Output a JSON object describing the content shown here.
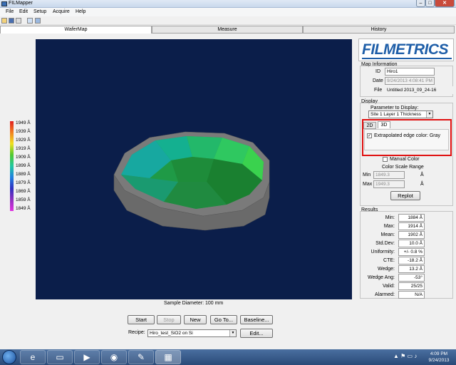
{
  "window": {
    "title": "FILMapper"
  },
  "menu": [
    "File",
    "Edit",
    "Setup",
    "Acquire",
    "Help"
  ],
  "tabs": {
    "wafermap": "WaferMap",
    "measure": "Measure",
    "history": "History"
  },
  "legend": [
    "1949 Å",
    "1939 Å",
    "1929 Å",
    "1919 Å",
    "1909 Å",
    "1899 Å",
    "1889 Å",
    "1879 Å",
    "1869 Å",
    "1859 Å",
    "1849 Å"
  ],
  "sample_diameter": "Sample Diameter: 100 mm",
  "buttons": {
    "start": "Start",
    "stop": "Stop",
    "new": "New",
    "goto": "Go To...",
    "baseline": "Baseline...",
    "edit": "Edit...",
    "replot": "Replot"
  },
  "recipe": {
    "label": "Recipe:",
    "value": "Hiro_test_SiO2 on Si"
  },
  "logo": "FILMETRICS",
  "map_info": {
    "title": "Map Information",
    "id_label": "ID",
    "id_value": "Hiro1",
    "date_label": "Date",
    "date_value": "9/24/2013 4:08:41 PM",
    "file_label": "File",
    "file_value": "Untitled 2013_09_24-16"
  },
  "display": {
    "title": "Display",
    "param_label": "Parameter to Display:",
    "param_value": "Site 1 Layer 1 Thickness",
    "tab_2d": "2D",
    "tab_3d": "3D",
    "extrapolated_label": "Extrapolated edge color: Gray",
    "extrapolated_checked": "✓",
    "manual_color_label": "Manual Color",
    "color_scale_title": "Color Scale Range",
    "min_label": "Min",
    "min_value": "1849.3",
    "min_unit": "Å",
    "max_label": "Max",
    "max_value": "1949.3",
    "max_unit": "Å"
  },
  "results": {
    "title": "Results",
    "rows": [
      {
        "label": "Min:",
        "value": "1884 Å"
      },
      {
        "label": "Max:",
        "value": "1914 Å"
      },
      {
        "label": "Mean:",
        "value": "1902 Å"
      },
      {
        "label": "Std.Dev:",
        "value": "10.0 Å"
      },
      {
        "label": "Uniformity:",
        "value": "+/- 0.8 %"
      },
      {
        "label": "CTE:",
        "value": "-18.2 Å"
      },
      {
        "label": "Wedge:",
        "value": "13.2 Å"
      },
      {
        "label": "Wedge Ang:",
        "value": "-53°"
      },
      {
        "label": "Valid:",
        "value": "25/25"
      },
      {
        "label": "Alarmed:",
        "value": "N/A"
      }
    ]
  },
  "taskbar": {
    "time": "4:09 PM",
    "date": "9/24/2013"
  }
}
